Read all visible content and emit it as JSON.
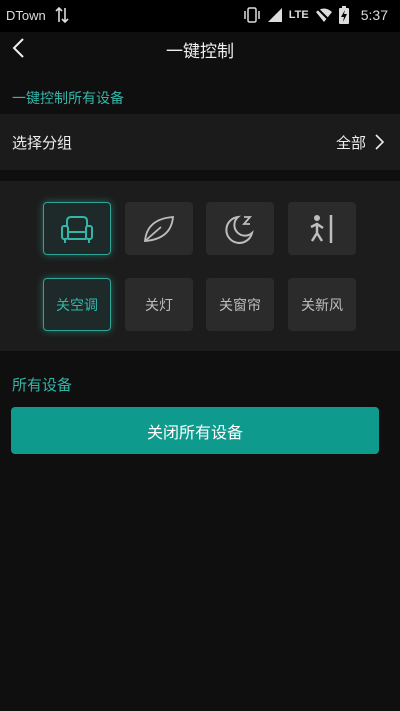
{
  "statusbar": {
    "carrier": "DTown",
    "network": "LTE",
    "time": "5:37"
  },
  "header": {
    "title": "一键控制"
  },
  "section_one": {
    "label": "一键控制所有设备"
  },
  "group_selector": {
    "label": "选择分组",
    "value": "全部"
  },
  "modes": [
    {
      "icon": "armchair-icon",
      "label": "关空调",
      "active": true
    },
    {
      "icon": "leaf-icon",
      "label": "关灯",
      "active": false
    },
    {
      "icon": "moon-sleep-icon",
      "label": "关窗帘",
      "active": false
    },
    {
      "icon": "person-door-icon",
      "label": "关新风",
      "active": false
    }
  ],
  "section_two": {
    "label": "所有设备"
  },
  "main_action": {
    "label": "关闭所有设备"
  },
  "colors": {
    "accent": "#0f9a8e",
    "accent_text": "#34b5a8",
    "background": "#0f0f0f"
  }
}
